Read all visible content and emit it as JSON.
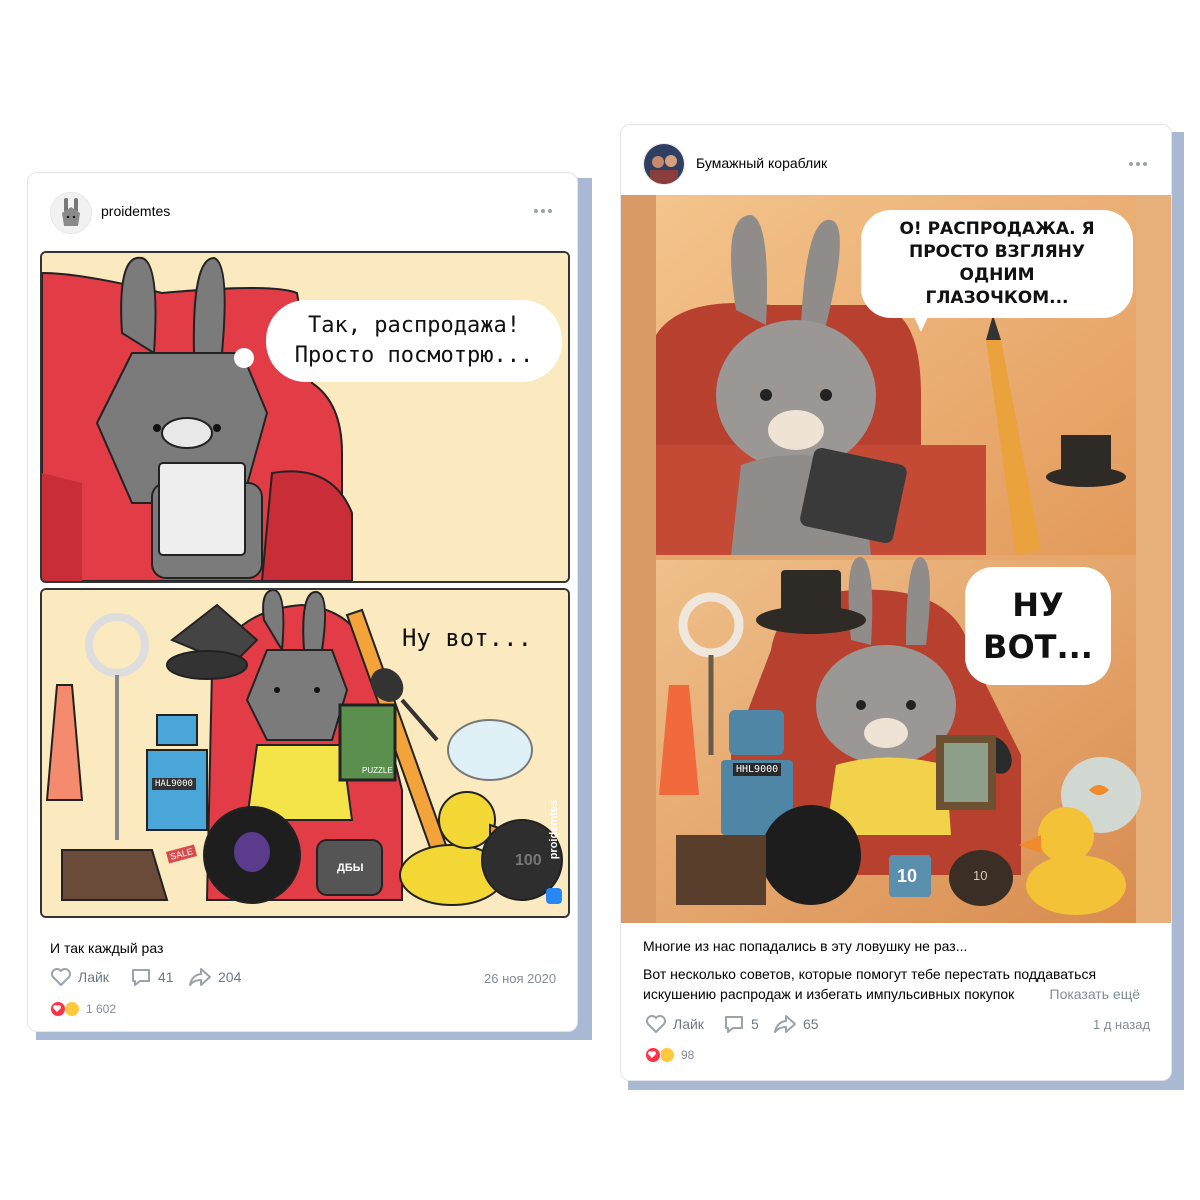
{
  "left_post": {
    "author": "proidemtes",
    "comic": {
      "panel1_speech": "Так, распродажа!\nПросто посмотрю...",
      "panel2_speech": "Ну вот...",
      "props": {
        "robot_label": "HAL9000",
        "puzzle_label": "PUZZLE",
        "sale_tag": "SALE",
        "barrel_label": "ДБЫ",
        "weight_label": "100",
        "watermark": "proidemtes"
      }
    },
    "caption": "И так каждый раз",
    "actions": {
      "like_label": "Лайк",
      "comments_count": "41",
      "shares_count": "204"
    },
    "date": "26 ноя 2020",
    "reactions_count": "1 602"
  },
  "right_post": {
    "author": "Бумажный кораблик",
    "comic": {
      "panel1_speech": "О! РАСПРОДАЖА. Я\nПРОСТО ВЗГЛЯНУ\nОДНИМ\nГЛАЗОЧКОМ...",
      "panel2_speech": "НУ\nВОТ...",
      "props": {
        "robot_label": "HHL9000",
        "block_label": "10",
        "weight_label": "10"
      }
    },
    "caption_line1": "Многие из нас попадались в эту ловушку не раз...",
    "caption_line2": "Вот несколько советов, которые помогут тебе перестать поддаваться искушению распродаж и избегать импульсивных покупок",
    "show_more_label": "Показать ещё",
    "actions": {
      "like_label": "Лайк",
      "comments_count": "5",
      "shares_count": "65"
    },
    "date": "1 д назад",
    "reactions_count": "98"
  },
  "colors": {
    "shadow": "#a9b8d3",
    "meta_text": "#818c99",
    "action_icon": "#99a2ad",
    "heart_reaction": "#ff3347",
    "laugh_reaction": "#ffc83d"
  },
  "icons": [
    "more-icon",
    "heart-icon",
    "comment-icon",
    "share-icon",
    "vk-icon"
  ]
}
